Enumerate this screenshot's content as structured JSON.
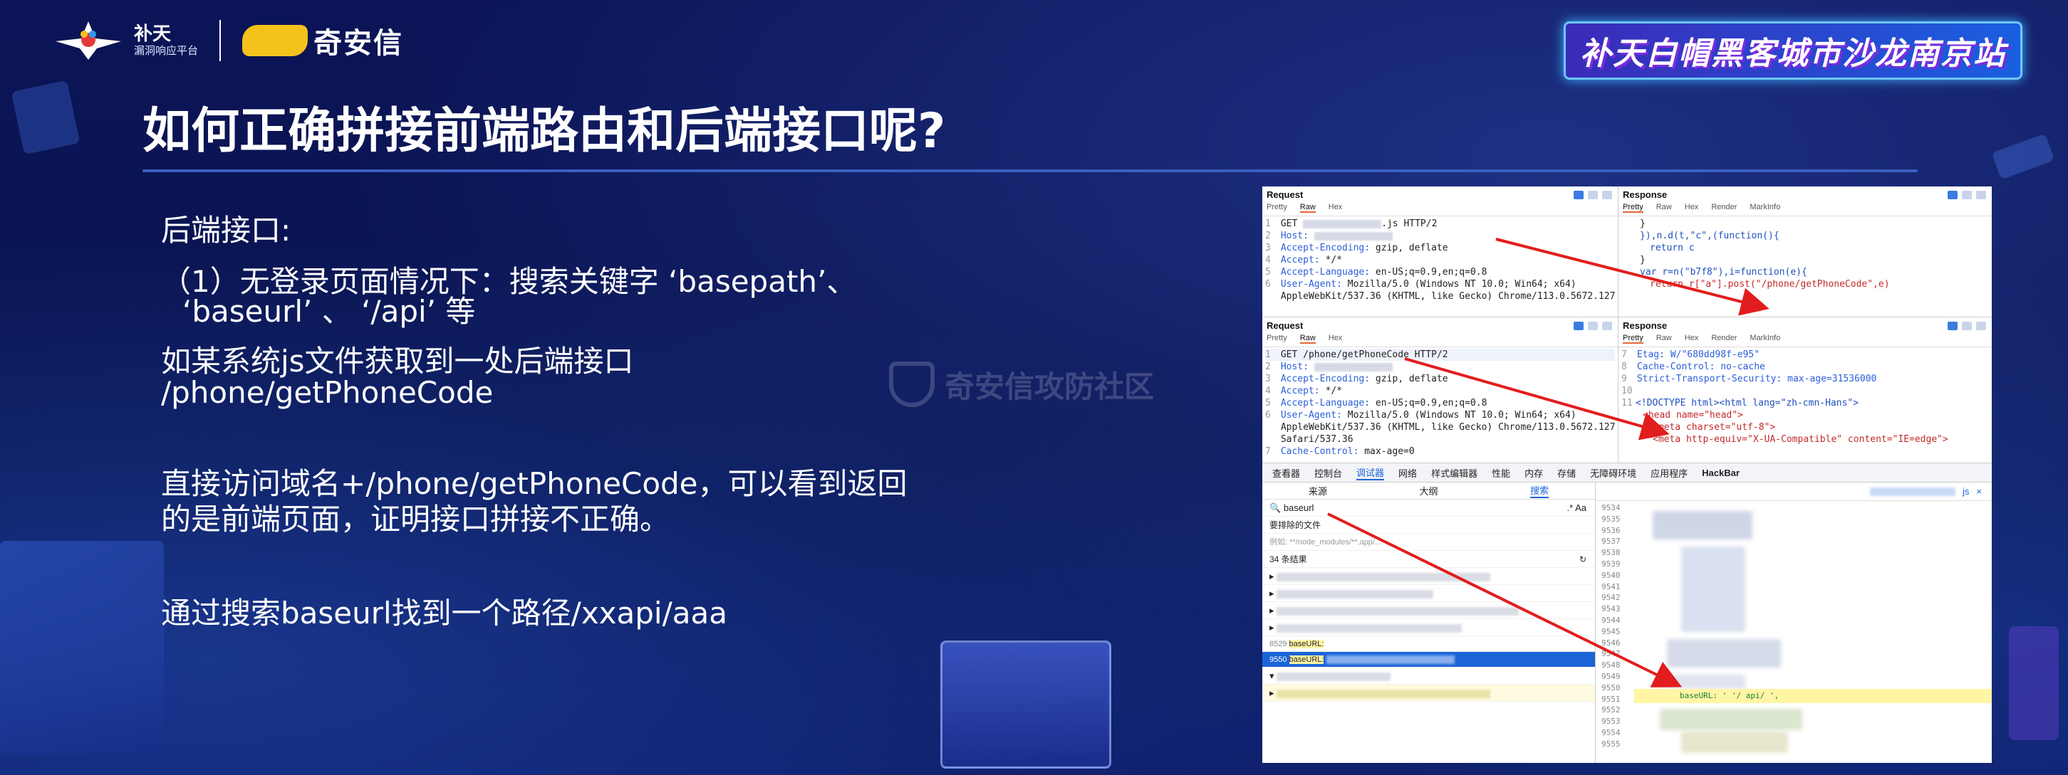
{
  "header": {
    "logo_main": "补天",
    "logo_sub": "漏洞响应平台",
    "partner_logo": "奇安信",
    "event_title": "补天白帽黑客城市沙龙南京站"
  },
  "slide": {
    "title": "如何正确拼接前端路由和后端接口呢?",
    "para1": "后端接口:",
    "para2_line1": "（1）无登录页面情况下：搜索关键字 ‘basepath’、",
    "para2_line2": "‘baseurl’ 、 ‘/api’ 等",
    "para3_line1": "如某系统js文件获取到一处后端接口",
    "para3_line2": "/phone/getPhoneCode",
    "para4_line1": "直接访问域名+/phone/getPhoneCode，可以看到返回",
    "para4_line2": "的是前端页面，证明接口拼接不正确。",
    "para5": "通过搜索baseurl找到一个路径/xxapi/aaa",
    "watermark": "奇安信攻防社区"
  },
  "burp1": {
    "req_title": "Request",
    "resp_title": "Response",
    "req_tabs": [
      "Pretty",
      "Raw",
      "Hex"
    ],
    "resp_tabs": [
      "Pretty",
      "Raw",
      "Hex",
      "Render",
      "MarkInfo"
    ],
    "req_lines": [
      {
        "n": "1",
        "k": "GET",
        "v": ".js HTTP/2"
      },
      {
        "n": "2",
        "k": "Host:",
        "v": ""
      },
      {
        "n": "3",
        "k": "Accept-Encoding:",
        "v": "gzip, deflate"
      },
      {
        "n": "4",
        "k": "Accept:",
        "v": "*/*"
      },
      {
        "n": "5",
        "k": "Accept-Language:",
        "v": "en-US;q=0.9,en;q=0.8"
      },
      {
        "n": "6",
        "k": "User-Agent:",
        "v": "Mozilla/5.0 (Windows NT 10.0; Win64; x64)"
      },
      {
        "n": "",
        "k": "",
        "v": "AppleWebKit/537.36 (KHTML, like Gecko) Chrome/113.0.5672.127"
      }
    ],
    "resp_lines": [
      {
        "t": "}"
      },
      {
        "t": "}),n.d(t,\"c\",(function(){"
      },
      {
        "t": "return c"
      },
      {
        "t": "}"
      },
      {
        "t": "var r=n(\"b7f8\"),i=function(e){"
      },
      {
        "t": "return r[\"a\"].post(\"/phone/getPhoneCode\",e)"
      }
    ]
  },
  "burp2": {
    "req_title": "Request",
    "resp_title": "Response",
    "req_tabs": [
      "Pretty",
      "Raw",
      "Hex"
    ],
    "resp_tabs": [
      "Pretty",
      "Raw",
      "Hex",
      "Render",
      "MarkInfo"
    ],
    "req_lines": [
      {
        "n": "1",
        "k": "GET",
        "v": "/phone/getPhoneCode HTTP/2"
      },
      {
        "n": "2",
        "k": "Host:",
        "v": ""
      },
      {
        "n": "3",
        "k": "Accept-Encoding:",
        "v": "gzip, deflate"
      },
      {
        "n": "4",
        "k": "Accept:",
        "v": "*/*"
      },
      {
        "n": "5",
        "k": "Accept-Language:",
        "v": "en-US;q=0.9,en;q=0.8"
      },
      {
        "n": "6",
        "k": "User-Agent:",
        "v": "Mozilla/5.0 (Windows NT 10.0; Win64; x64)"
      },
      {
        "n": "",
        "k": "",
        "v": "AppleWebKit/537.36 (KHTML, like Gecko) Chrome/113.0.5672.127"
      },
      {
        "n": "",
        "k": "",
        "v": "Safari/537.36"
      },
      {
        "n": "7",
        "k": "Cache-Control:",
        "v": "max-age=0"
      }
    ],
    "resp_lines": [
      {
        "n": "7",
        "t": "Etag: W/\"680dd98f-e95\""
      },
      {
        "n": "8",
        "t": "Cache-Control: no-cache"
      },
      {
        "n": "9",
        "t": "Strict-Transport-Security: max-age=31536000"
      },
      {
        "n": "10",
        "t": ""
      },
      {
        "n": "11",
        "t": "<!DOCTYPE html><html lang=\"zh-cmn-Hans\">"
      },
      {
        "n": "",
        "t": "<head name=\"head\">"
      },
      {
        "n": "",
        "t": "<meta charset=\"utf-8\">"
      },
      {
        "n": "",
        "t": "<meta http-equiv=\"X-UA-Compatible\" content=\"IE=edge\">"
      }
    ]
  },
  "devtools": {
    "tabs": [
      "查看器",
      "控制台",
      "调试器",
      "网络",
      "样式编辑器",
      "性能",
      "内存",
      "存储",
      "无障碍环境",
      "应用程序",
      "HackBar"
    ],
    "active_tab": "调试器",
    "subtabs": [
      "来源",
      "大纲",
      "搜索"
    ],
    "active_subtab": "搜索",
    "search_value": "baseurl",
    "search_opts": ".* Aa",
    "exclude_label": "要排除的文件",
    "exclude_placeholder": "例如: **/node_modules/**,app/...",
    "results_count": "34 条结果",
    "result_rows": [
      {
        "n": "8529",
        "k": "baseURL:",
        "sel": false
      },
      {
        "n": "9550",
        "k": "baseURL:",
        "sel": true
      }
    ],
    "gutter_start": [
      "9534",
      "9535",
      "9536",
      "9537",
      "9538",
      "9539",
      "9540",
      "9541",
      "9542",
      "9543",
      "9544",
      "9545",
      "9546",
      "9547",
      "9548",
      "9549",
      "9550",
      "9551",
      "9552",
      "9553",
      "9554",
      "9555"
    ],
    "code_line": "baseURL: '          '/  api/      ',",
    "file_tab": "js",
    "file_close": "×"
  }
}
